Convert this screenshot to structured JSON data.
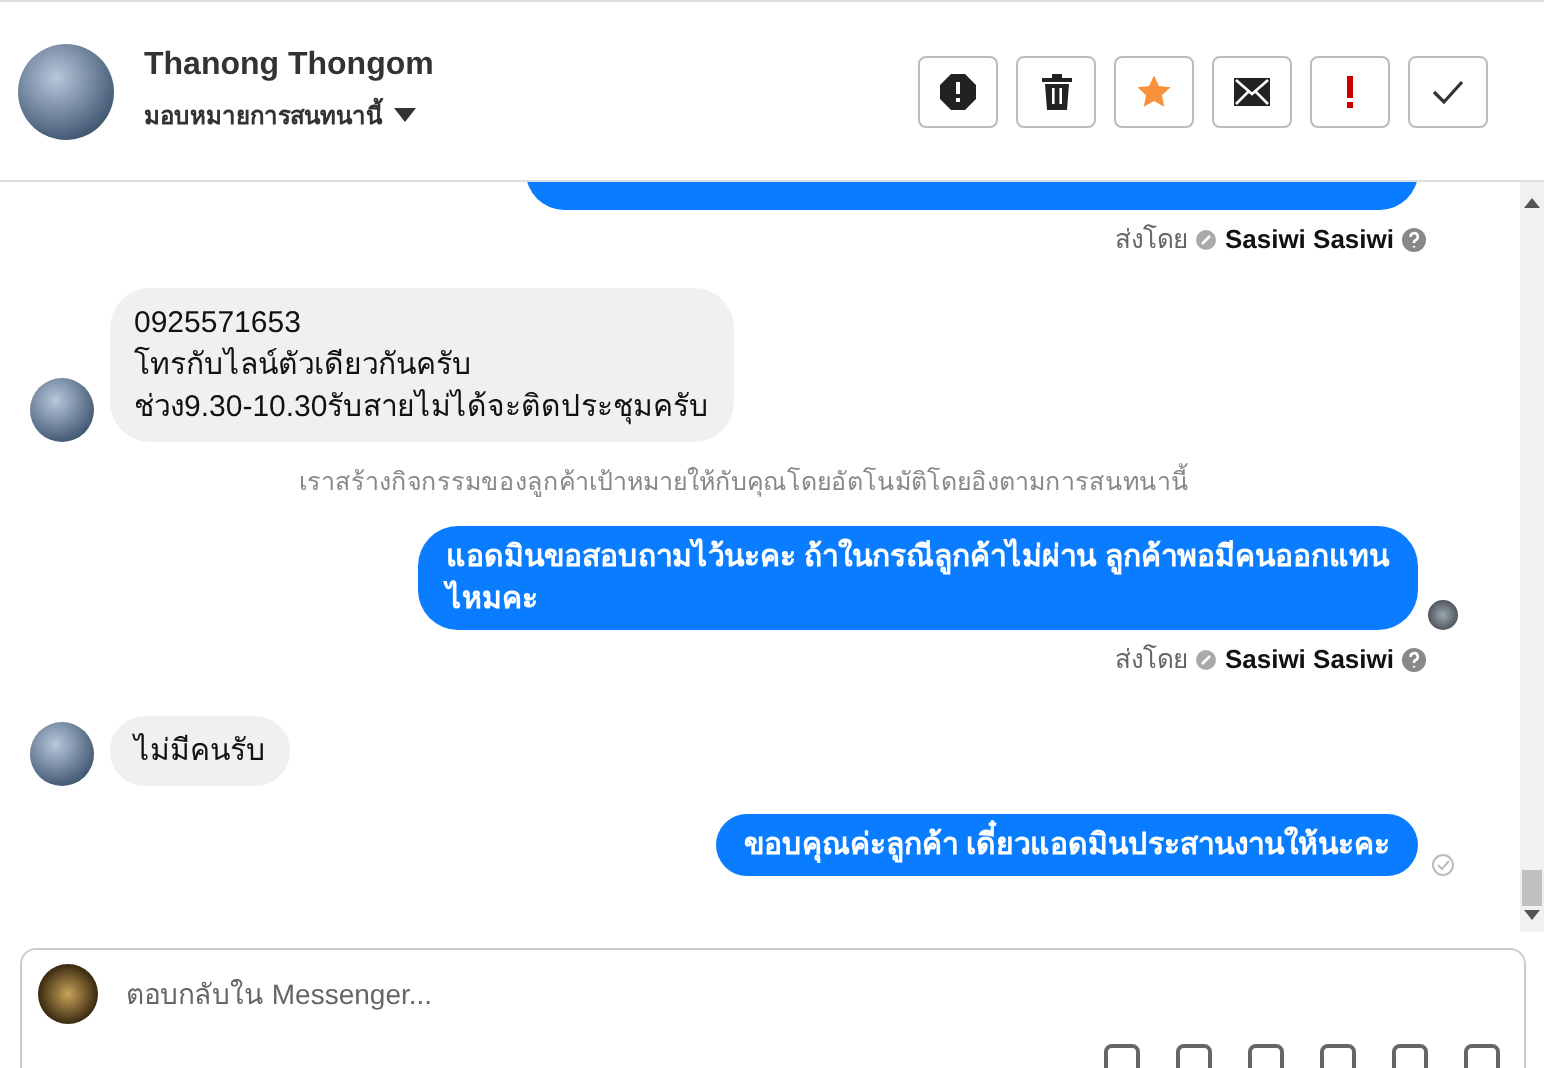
{
  "header": {
    "name": "Thanong Thongom",
    "assign_label": "มอบหมายการสนทนานี้"
  },
  "actions": [
    {
      "kind": "spam"
    },
    {
      "kind": "delete"
    },
    {
      "kind": "star"
    },
    {
      "kind": "mail"
    },
    {
      "kind": "important"
    },
    {
      "kind": "done"
    }
  ],
  "messages": [
    {
      "kind": "clipped"
    },
    {
      "kind": "sent_by",
      "label": "ส่งโดย",
      "agent": "Sasiwi Sasiwi"
    },
    {
      "kind": "incoming",
      "text": "0925571653\nโทรกับไลน์ตัวเดียวกันครับ\nช่วง9.30-10.30รับสายไม่ได้จะติดประชุมครับ"
    },
    {
      "kind": "system",
      "text": "เราสร้างกิจกรรมของลูกค้าเป้าหมายให้กับคุณโดยอัตโนมัติโดยอิงตามการสนทนานี้"
    },
    {
      "kind": "outgoing",
      "seen": true,
      "text": "แอดมินขอสอบถามไว้นะคะ ถ้าในกรณีลูกค้าไม่ผ่าน ลูกค้าพอมีคนออกแทนไหมคะ"
    },
    {
      "kind": "sent_by",
      "label": "ส่งโดย",
      "agent": "Sasiwi Sasiwi"
    },
    {
      "kind": "incoming",
      "text": "ไม่มีคนรับ"
    },
    {
      "kind": "outgoing",
      "seen": false,
      "text": "ขอบคุณค่ะลูกค้า เดี๋ยวแอดมินประสานงานให้นะคะ"
    }
  ],
  "composer": {
    "placeholder": "ตอบกลับใน Messenger..."
  }
}
